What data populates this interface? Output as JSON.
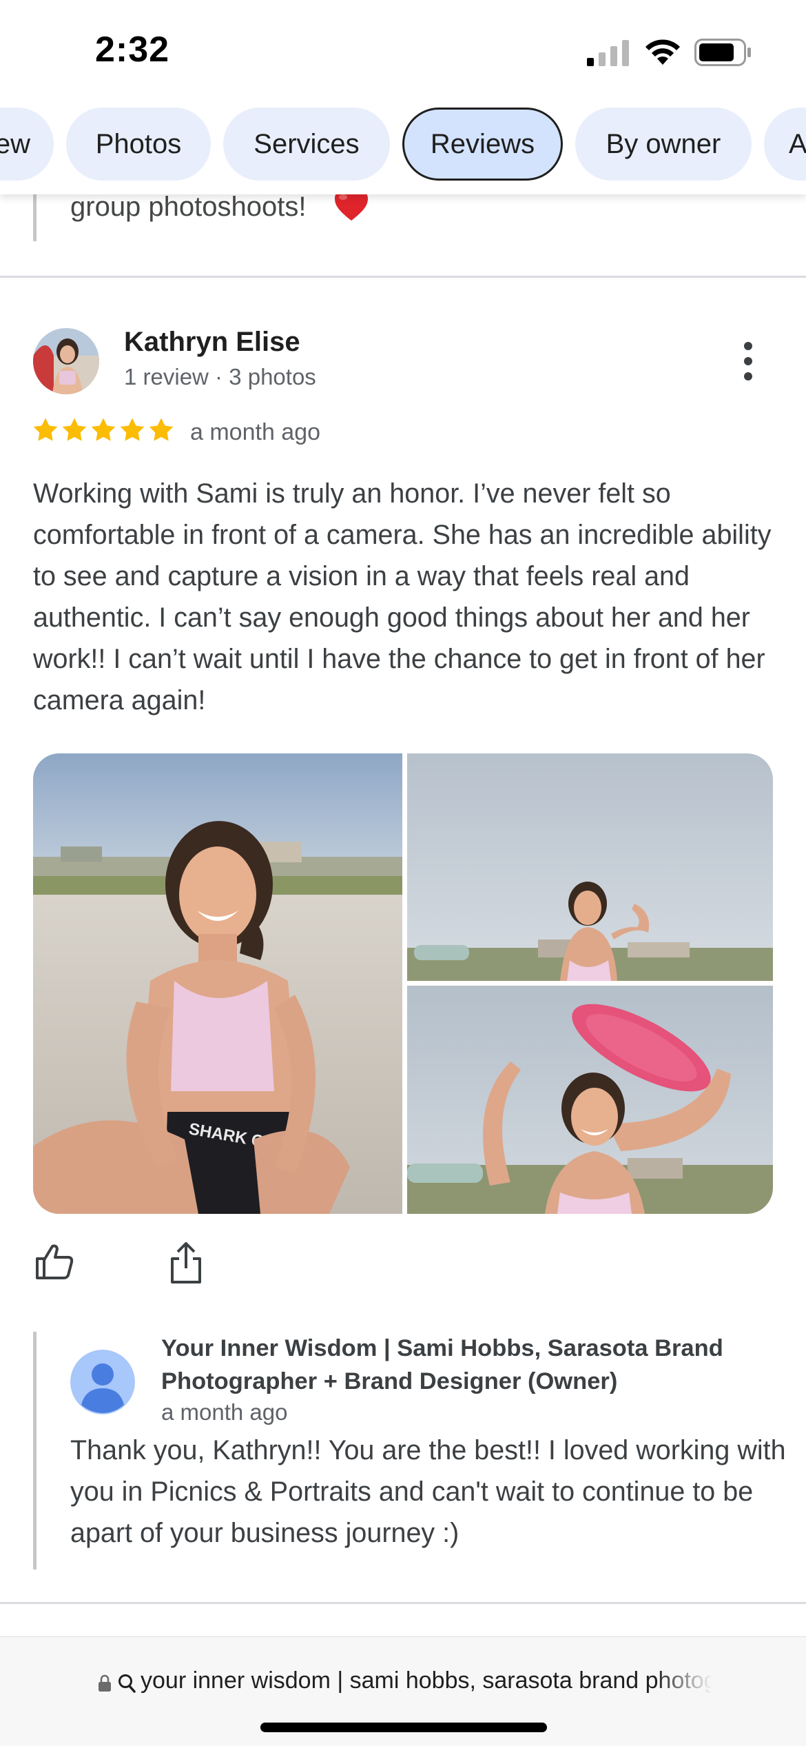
{
  "status_bar": {
    "time": "2:32"
  },
  "tabs": [
    {
      "label": "ew",
      "selected": false
    },
    {
      "label": "Photos",
      "selected": false
    },
    {
      "label": "Services",
      "selected": false
    },
    {
      "label": "Reviews",
      "selected": true
    },
    {
      "label": "By owner",
      "selected": false
    },
    {
      "label": "A",
      "selected": false
    }
  ],
  "previous_review": {
    "tail_text": "group photoshoots!",
    "emoji": "heart-icon"
  },
  "review": {
    "reviewer_name": "Kathryn Elise",
    "reviewer_meta": "1 review · 3 photos",
    "rating": 5,
    "time": "a month ago",
    "text": "Working with Sami is truly an honor. I’ve never felt so comfortable in front of a camera. She has an incredible ability to see and capture a vision in a way that feels real and authentic. I can’t say enough good things about her and her work!! I can’t wait until I have the chance to get in front of her camera again!",
    "photo_count": 3
  },
  "owner_response": {
    "name": "Your Inner Wisdom | Sami Hobbs, Sarasota Brand Photographer + Brand Designer (Owner)",
    "time": "a month ago",
    "text": "Thank you, Kathryn!! You are the best!! I loved working with you in Picnics & Portraits and can't wait to continue to be apart of your business journey :)"
  },
  "browser": {
    "url_text": "your inner wisdom | sami hobbs, sarasota brand photographer"
  },
  "colors": {
    "chip_bg": "#e8eefb",
    "chip_selected_bg": "#d3e3fd",
    "star": "#fbbc04",
    "divider": "#dadce0",
    "owner_avatar": "#4a7de0"
  }
}
